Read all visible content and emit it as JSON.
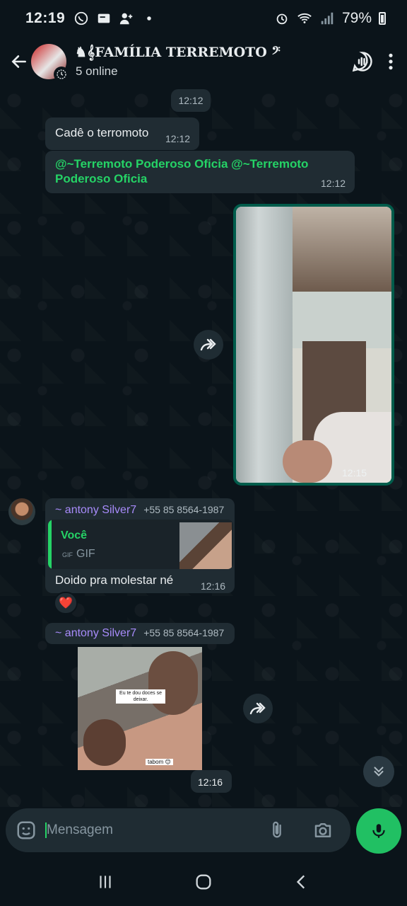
{
  "status_bar": {
    "time": "12:19",
    "battery": "79%"
  },
  "header": {
    "title": "♞𝄞FAMÍLIA TERREMOTO 𝄢",
    "subtitle": "5 online"
  },
  "messages": {
    "date_pill": "12:12",
    "msg1": {
      "text": "Cadê o terromoto",
      "time": "12:12"
    },
    "msg2": {
      "text": "@~Terremoto Poderoso Oficia @~Terremoto Poderoso Oficia",
      "time": "12:12"
    },
    "video_msg": {
      "time": "12:15"
    },
    "msg3": {
      "sender": "~ antony Silver7",
      "phone": "+55 85 8564-1987",
      "reply_author": "Você",
      "reply_type": "GIF",
      "reply_badge": "GIF",
      "text": "Doido pra molestar né",
      "time": "12:16",
      "reaction": "❤️"
    },
    "msg4": {
      "sender": "~ antony Silver7",
      "phone": "+55 85 8564-1987",
      "sticker_caption_1": "Eu te dou doces se deixar.",
      "sticker_caption_2": "tabom 😊",
      "time": "12:16"
    }
  },
  "input": {
    "placeholder": "Mensagem"
  },
  "icons": {
    "back": "arrow-left-icon",
    "voice_call": "voice-chat-icon",
    "menu": "more-vert-icon",
    "emoji": "sticker-icon",
    "attach": "paperclip-icon",
    "camera": "camera-icon",
    "mic": "mic-icon",
    "forward": "forward-icon",
    "scroll_down": "chevron-double-down-icon"
  },
  "colors": {
    "accent": "#25d366",
    "bubble": "#202c33",
    "background": "#0b141a",
    "sender": "#a78bfa"
  }
}
